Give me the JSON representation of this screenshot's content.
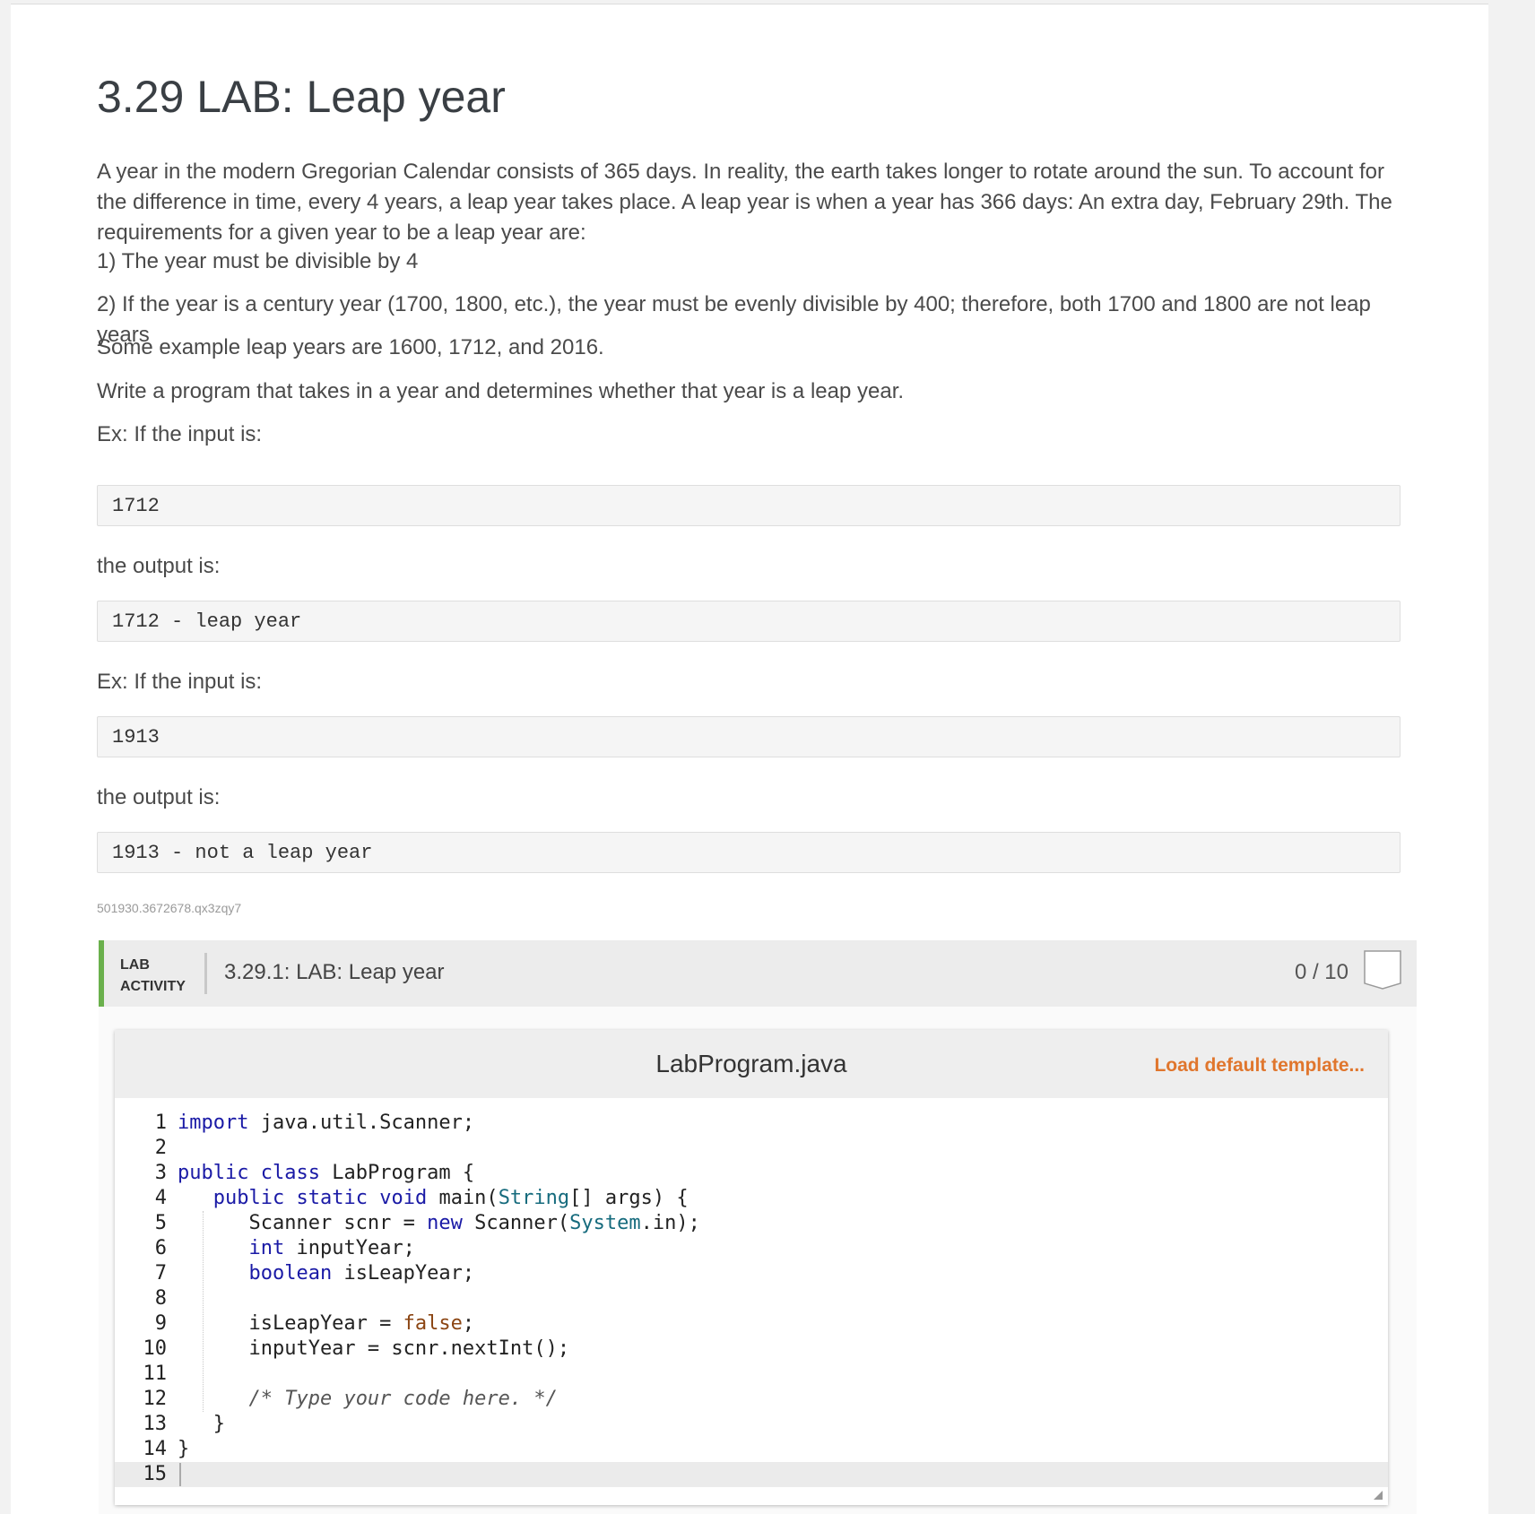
{
  "title": "3.29 LAB: Leap year",
  "intro": "A year in the modern Gregorian Calendar consists of 365 days. In reality, the earth takes longer to rotate around the sun. To account for the difference in time, every 4 years, a leap year takes place. A leap year is when a year has 366 days: An extra day, February 29th. The requirements for a given year to be a leap year are:",
  "rule1": "1) The year must be divisible by 4",
  "rule2": "2) If the year is a century year (1700, 1800, etc.), the year must be evenly divisible by 400; therefore, both 1700 and 1800 are not leap years",
  "examples_text": "Some example leap years are 1600, 1712, and 2016.",
  "task": "Write a program that takes in a year and determines whether that year is a leap year.",
  "ex1_label": "Ex: If the input is:",
  "ex1_input": "1712",
  "ex1_output_label": "the output is:",
  "ex1_output": "1712 - leap year",
  "ex2_label": "Ex: If the input is:",
  "ex2_input": "1913",
  "ex2_output_label": "the output is:",
  "ex2_output": "1913 - not a leap year",
  "content_id": "501930.3672678.qx3zqy7",
  "lab": {
    "tag_line1": "LAB",
    "tag_line2": "ACTIVITY",
    "title": "3.29.1: LAB: Leap year",
    "score": "0 / 10",
    "accent": "#6ab04c"
  },
  "editor": {
    "filename": "LabProgram.java",
    "load_template": "Load default template...",
    "line_numbers": [
      "1",
      "2",
      "3",
      "4",
      "5",
      "6",
      "7",
      "8",
      "9",
      "10",
      "11",
      "12",
      "13",
      "14",
      "15"
    ]
  }
}
